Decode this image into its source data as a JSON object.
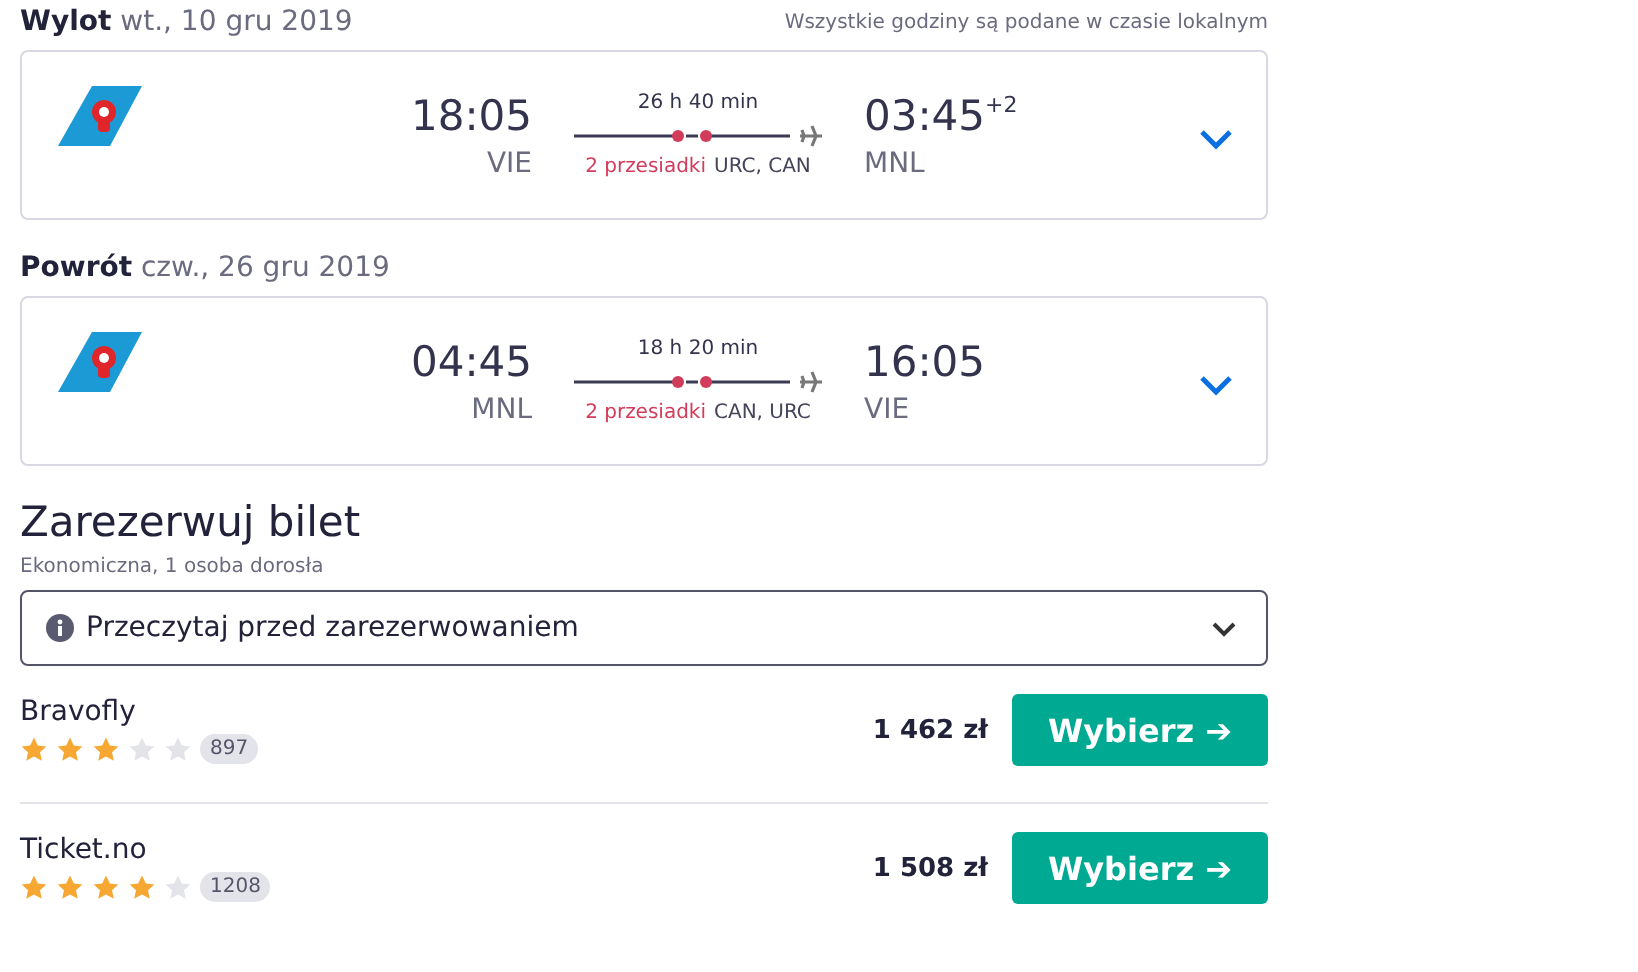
{
  "legs": [
    {
      "label": "Wylot",
      "date": "wt., 10 gru 2019",
      "note": "Wszystkie godziny są podane w czasie lokalnym",
      "dep_time": "18:05",
      "dep_airport": "VIE",
      "duration": "26 h 40 min",
      "stops": "2 przesiadki",
      "stop_airports": "URC, CAN",
      "arr_time": "03:45",
      "day_offset": "+2",
      "arr_airport": "MNL",
      "expanded": false
    },
    {
      "label": "Powrót",
      "date": "czw., 26 gru 2019",
      "dep_time": "04:45",
      "dep_airport": "MNL",
      "duration": "18 h 20 min",
      "stops": "2 przesiadki",
      "stop_airports": "CAN, URC",
      "arr_time": "16:05",
      "arr_airport": "VIE",
      "expanded": false
    }
  ],
  "booking": {
    "title": "Zarezerwuj bilet",
    "subtitle": "Ekonomiczna, 1 osoba dorosła",
    "notice": "Przeczytaj przed zarezerwowaniem",
    "notice_expanded": false,
    "offers": [
      {
        "provider": "Bravofly",
        "stars": 3,
        "reviews": "897",
        "price": "1 462 zł",
        "button": "Wybierz",
        "arrow": "➔"
      },
      {
        "provider": "Ticket.no",
        "stars": 4,
        "reviews": "1208",
        "price": "1 508 zł",
        "button": "Wybierz",
        "arrow": "➔"
      }
    ]
  }
}
